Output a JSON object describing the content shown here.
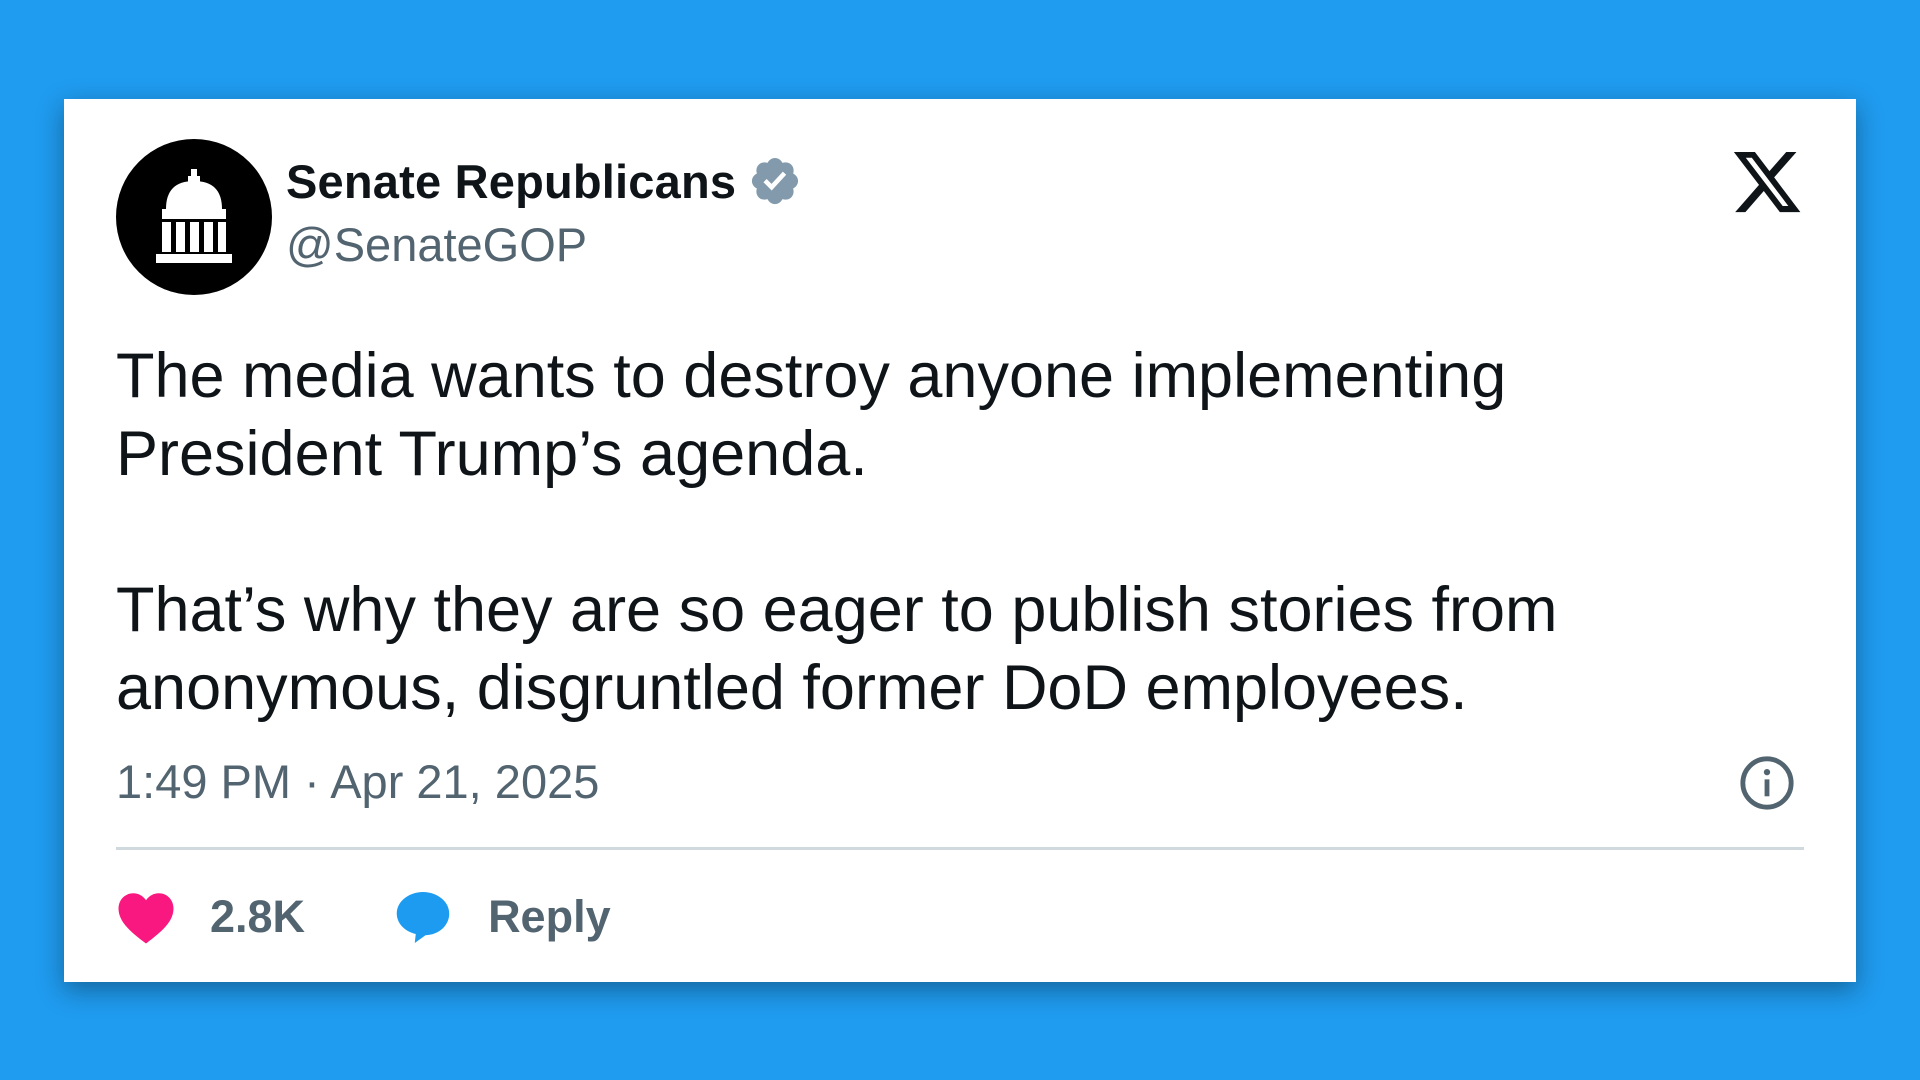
{
  "account": {
    "display_name": "Senate Republicans",
    "handle": "@SenateGOP",
    "verified": true,
    "verified_color": "#829aab"
  },
  "tweet": {
    "paragraphs": [
      "The media wants to destroy anyone implementing President Trump’s agenda.",
      "That’s why they are so eager to publish stories from anonymous, disgruntled former DoD employees."
    ],
    "timestamp": "1:49 PM · Apr 21, 2025"
  },
  "actions": {
    "like_count": "2.8K",
    "reply_label": "Reply"
  },
  "icons": {
    "avatar": "capitol-dome-icon",
    "verified": "verified-badge-icon",
    "brand": "x-logo-icon",
    "info": "info-icon",
    "like": "heart-icon",
    "reply": "speech-bubble-icon"
  },
  "colors": {
    "background": "#1f9bef",
    "card": "#ffffff",
    "text": "#0f1419",
    "muted": "#536471",
    "like": "#f91880",
    "reply": "#1d9bf0",
    "divider": "#cfd9de"
  }
}
